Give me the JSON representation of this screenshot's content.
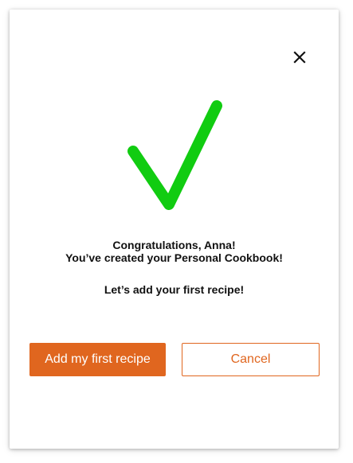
{
  "dialog": {
    "close_icon": "close-icon",
    "success_icon": "checkmark-icon",
    "message": {
      "line1": "Congratulations, Anna!",
      "line2": "You’ve created your Personal Cookbook!",
      "line3": "Let’s add your first recipe!"
    },
    "buttons": {
      "primary_label": "Add my first recipe",
      "secondary_label": "Cancel"
    }
  },
  "colors": {
    "accent": "#e0661f",
    "check": "#11cc11",
    "text": "#111111"
  }
}
